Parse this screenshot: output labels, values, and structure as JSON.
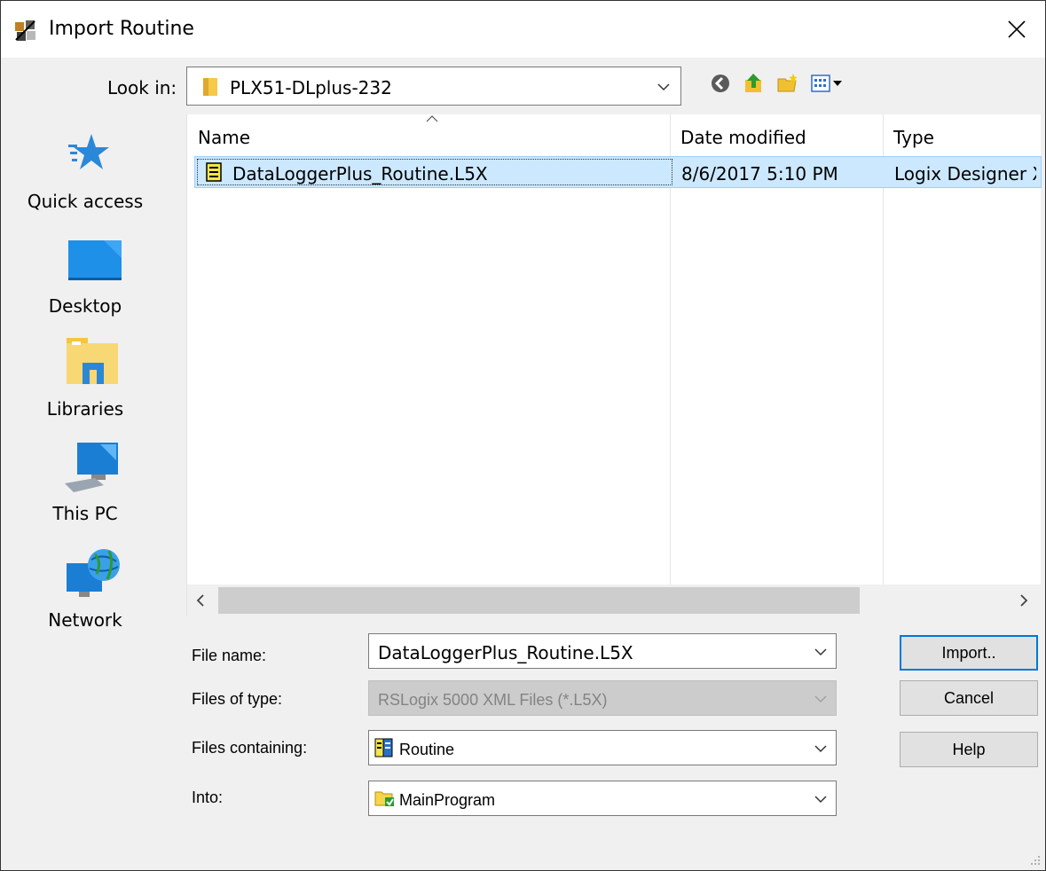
{
  "window": {
    "title": "Import Routine"
  },
  "lookin": {
    "label": "Look in:",
    "value": "PLX51-DLplus-232"
  },
  "toolbar": {
    "icons": [
      "back-icon",
      "up-folder-icon",
      "new-folder-icon",
      "view-menu-icon"
    ]
  },
  "places": [
    {
      "label": "Quick access",
      "icon": "quick-access-star-icon"
    },
    {
      "label": "Desktop",
      "icon": "desktop-icon"
    },
    {
      "label": "Libraries",
      "icon": "libraries-icon"
    },
    {
      "label": "This PC",
      "icon": "this-pc-icon"
    },
    {
      "label": "Network",
      "icon": "network-icon"
    }
  ],
  "filelist": {
    "columns": [
      "Name",
      "Date modified",
      "Type"
    ],
    "rows": [
      {
        "name": "DataLoggerPlus_Routine.L5X",
        "date": "8/6/2017 5:10 PM",
        "type": "Logix Designer XML",
        "selected": true
      }
    ]
  },
  "form": {
    "file_name_label": "File name:",
    "file_name_value": "DataLoggerPlus_Routine.L5X",
    "files_of_type_label": "Files of type:",
    "files_of_type_value": "RSLogix 5000 XML Files (*.L5X)",
    "files_containing_label": "Files containing:",
    "files_containing_value": "Routine",
    "into_label": "Into:",
    "into_value": "MainProgram"
  },
  "buttons": {
    "import": "Import..",
    "cancel": "Cancel",
    "help": "Help"
  },
  "colors": {
    "selection": "#cce8ff",
    "selection_border": "#99d1ff",
    "default_button_border": "#0078d7"
  }
}
